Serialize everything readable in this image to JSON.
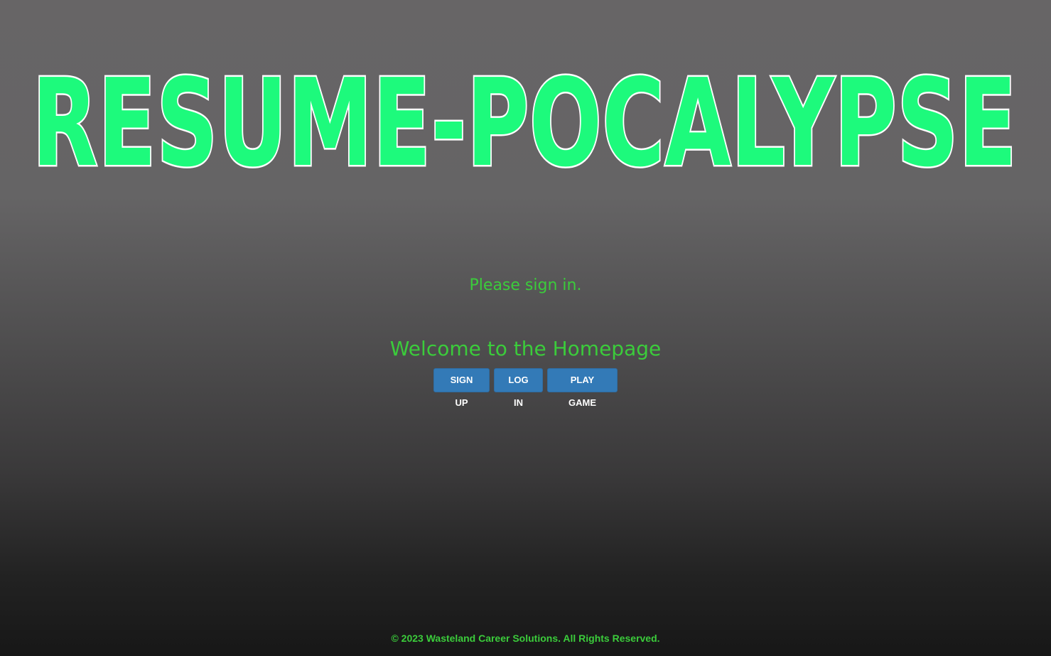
{
  "header": {
    "logo_text": "RESUME-POCALYPSE"
  },
  "main": {
    "status_text": "Please sign in.",
    "welcome_heading": "Welcome to the Homepage",
    "buttons": {
      "signup_label": "SIGN UP",
      "login_label": "LOG IN",
      "play_label": "PLAY GAME"
    }
  },
  "footer": {
    "copyright": "© 2023 Wasteland Career Solutions. All Rights Reserved."
  },
  "colors": {
    "logo_fill": "#1dfa7c",
    "logo_outline": "#ffffff",
    "text_green": "#3bcc3b",
    "button_blue": "#337ab7",
    "background_top": "#676566",
    "background_bottom": "#171717"
  }
}
